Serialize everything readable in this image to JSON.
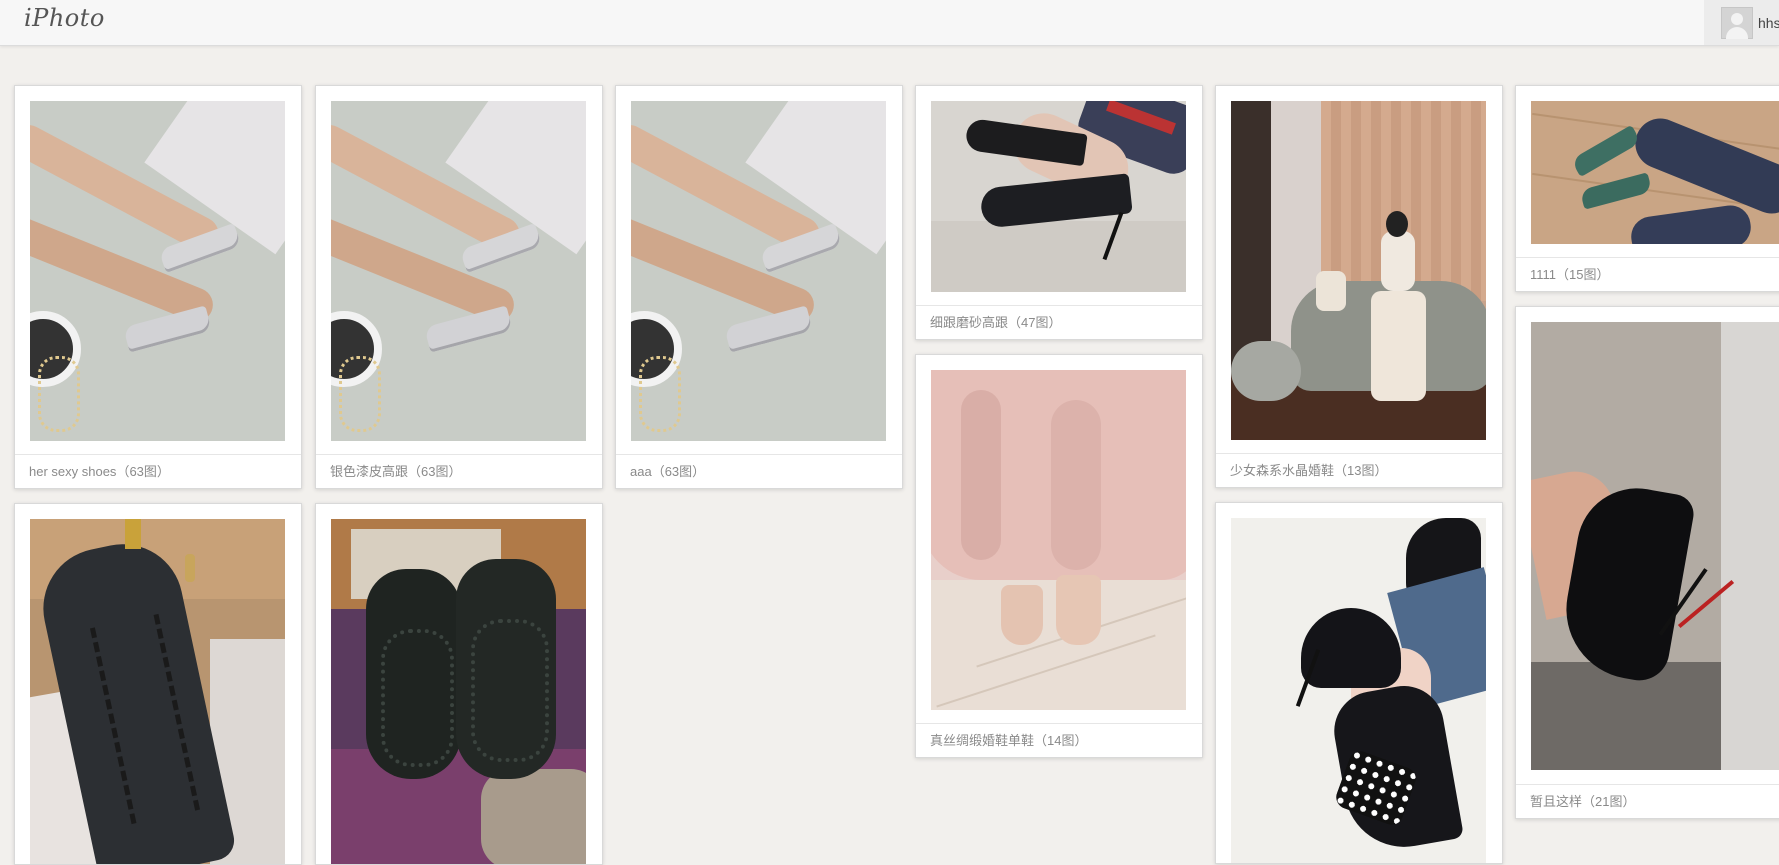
{
  "app": {
    "logo": "iPhoto"
  },
  "user": {
    "name": "hhs",
    "avatar_icon": "default-user-avatar-icon"
  },
  "albums": [
    {
      "title": "her sexy shoes",
      "count": "（63图）",
      "photo": "silver-heels-photo"
    },
    {
      "title": "银色漆皮高跟",
      "count": "（63图）",
      "photo": "silver-heels-photo"
    },
    {
      "title": "aaa",
      "count": "（63图）",
      "photo": "silver-heels-photo"
    },
    {
      "title": "细跟磨砂高跟",
      "count": "（47图）",
      "photo": "black-suede-heels-photo"
    },
    {
      "title": "少女森系水晶婚鞋",
      "count": "（13图）",
      "photo": "woman-on-sofa-photo"
    },
    {
      "title": "1111",
      "count": "（15图）",
      "photo": "green-heels-photo"
    },
    {
      "title": "真丝绸缎婚鞋单鞋",
      "count": "（14图）",
      "photo": "pink-dress-nude-heels-photo"
    },
    {
      "title": "暂且这样",
      "count": "（21图）",
      "photo": "black-patent-heel-photo"
    },
    {
      "title": "",
      "count": "",
      "photo": "black-sneaker-photo"
    },
    {
      "title": "",
      "count": "",
      "photo": "black-shoe-soles-photo"
    },
    {
      "title": "",
      "count": "",
      "photo": "polka-dot-bow-heels-photo"
    }
  ],
  "colors": {
    "page_background": "#f2f0ed",
    "card_background": "#ffffff",
    "caption_text": "#8a8a8a"
  }
}
